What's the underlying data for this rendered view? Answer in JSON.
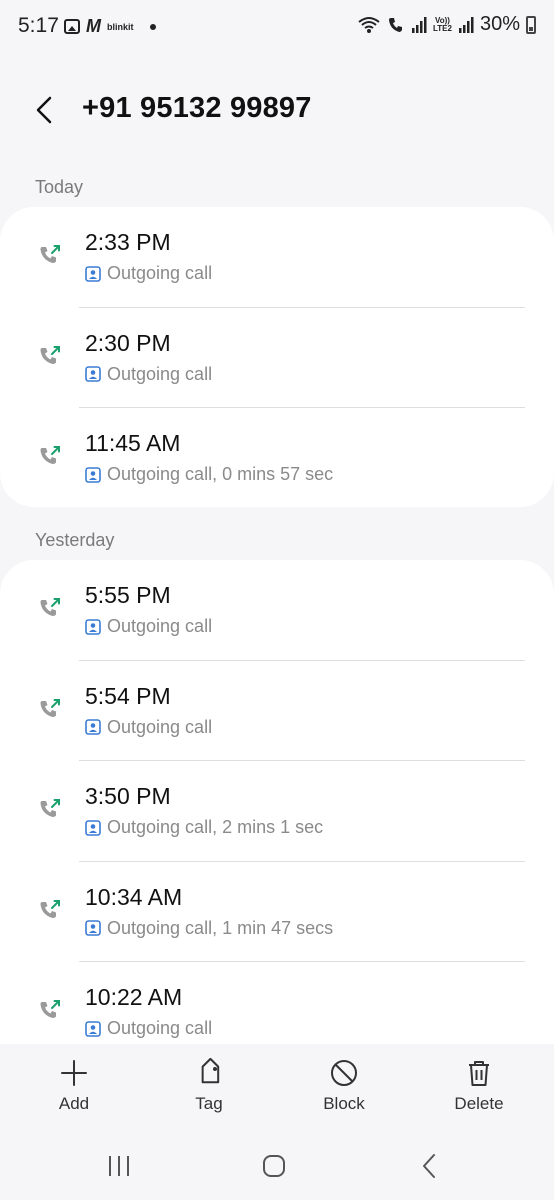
{
  "status_bar": {
    "time": "5:17",
    "brand_m": "M",
    "brand_text": "blinkit",
    "network_label_top": "Vo))",
    "network_label_bottom": "LTE2",
    "battery": "30%"
  },
  "header": {
    "title": "+91 95132 99897"
  },
  "sections": [
    {
      "label": "Today",
      "calls": [
        {
          "time": "2:33 PM",
          "desc": "Outgoing call"
        },
        {
          "time": "2:30 PM",
          "desc": "Outgoing call"
        },
        {
          "time": "11:45 AM",
          "desc": "Outgoing call, 0 mins 57 sec"
        }
      ]
    },
    {
      "label": "Yesterday",
      "calls": [
        {
          "time": "5:55 PM",
          "desc": "Outgoing call"
        },
        {
          "time": "5:54 PM",
          "desc": "Outgoing call"
        },
        {
          "time": "3:50 PM",
          "desc": "Outgoing call, 2 mins 1 sec"
        },
        {
          "time": "10:34 AM",
          "desc": "Outgoing call, 1 min 47 secs"
        },
        {
          "time": "10:22 AM",
          "desc": "Outgoing call"
        }
      ]
    }
  ],
  "actions": {
    "add": "Add",
    "tag": "Tag",
    "block": "Block",
    "delete": "Delete"
  },
  "colors": {
    "outgoing_arrow": "#1aa06d",
    "contact_badge": "#3a7bd5",
    "phone_gray": "#9a9a9a"
  }
}
